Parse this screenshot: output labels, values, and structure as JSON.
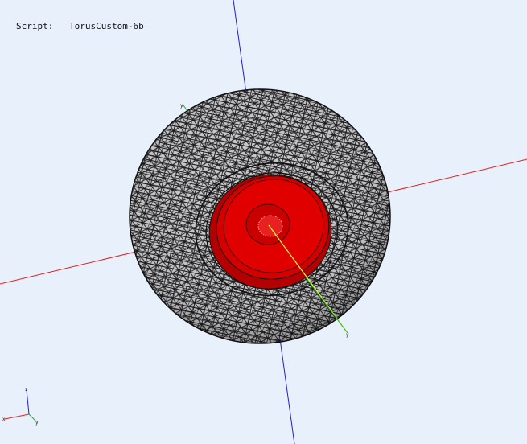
{
  "script": {
    "label": "Script:",
    "value": "TorusCustom-6b"
  },
  "colors": {
    "background": "#e8f0fb",
    "x_axis": "#e02020",
    "y_axis": "#20b020",
    "z_axis": "#2020d0",
    "mesh_fill": "#c8c8cc",
    "mesh_lines": "#111111",
    "inner_disc": "#d40000",
    "inner_disc_dark": "#8a0000",
    "probe_line": "#e8ff40"
  },
  "scene": {
    "object": "torus-mesh",
    "axis_triad_labels": [
      "z",
      "x",
      "y"
    ],
    "axis_end_labels": {
      "y_top": "y",
      "y_bottom": "y"
    }
  }
}
